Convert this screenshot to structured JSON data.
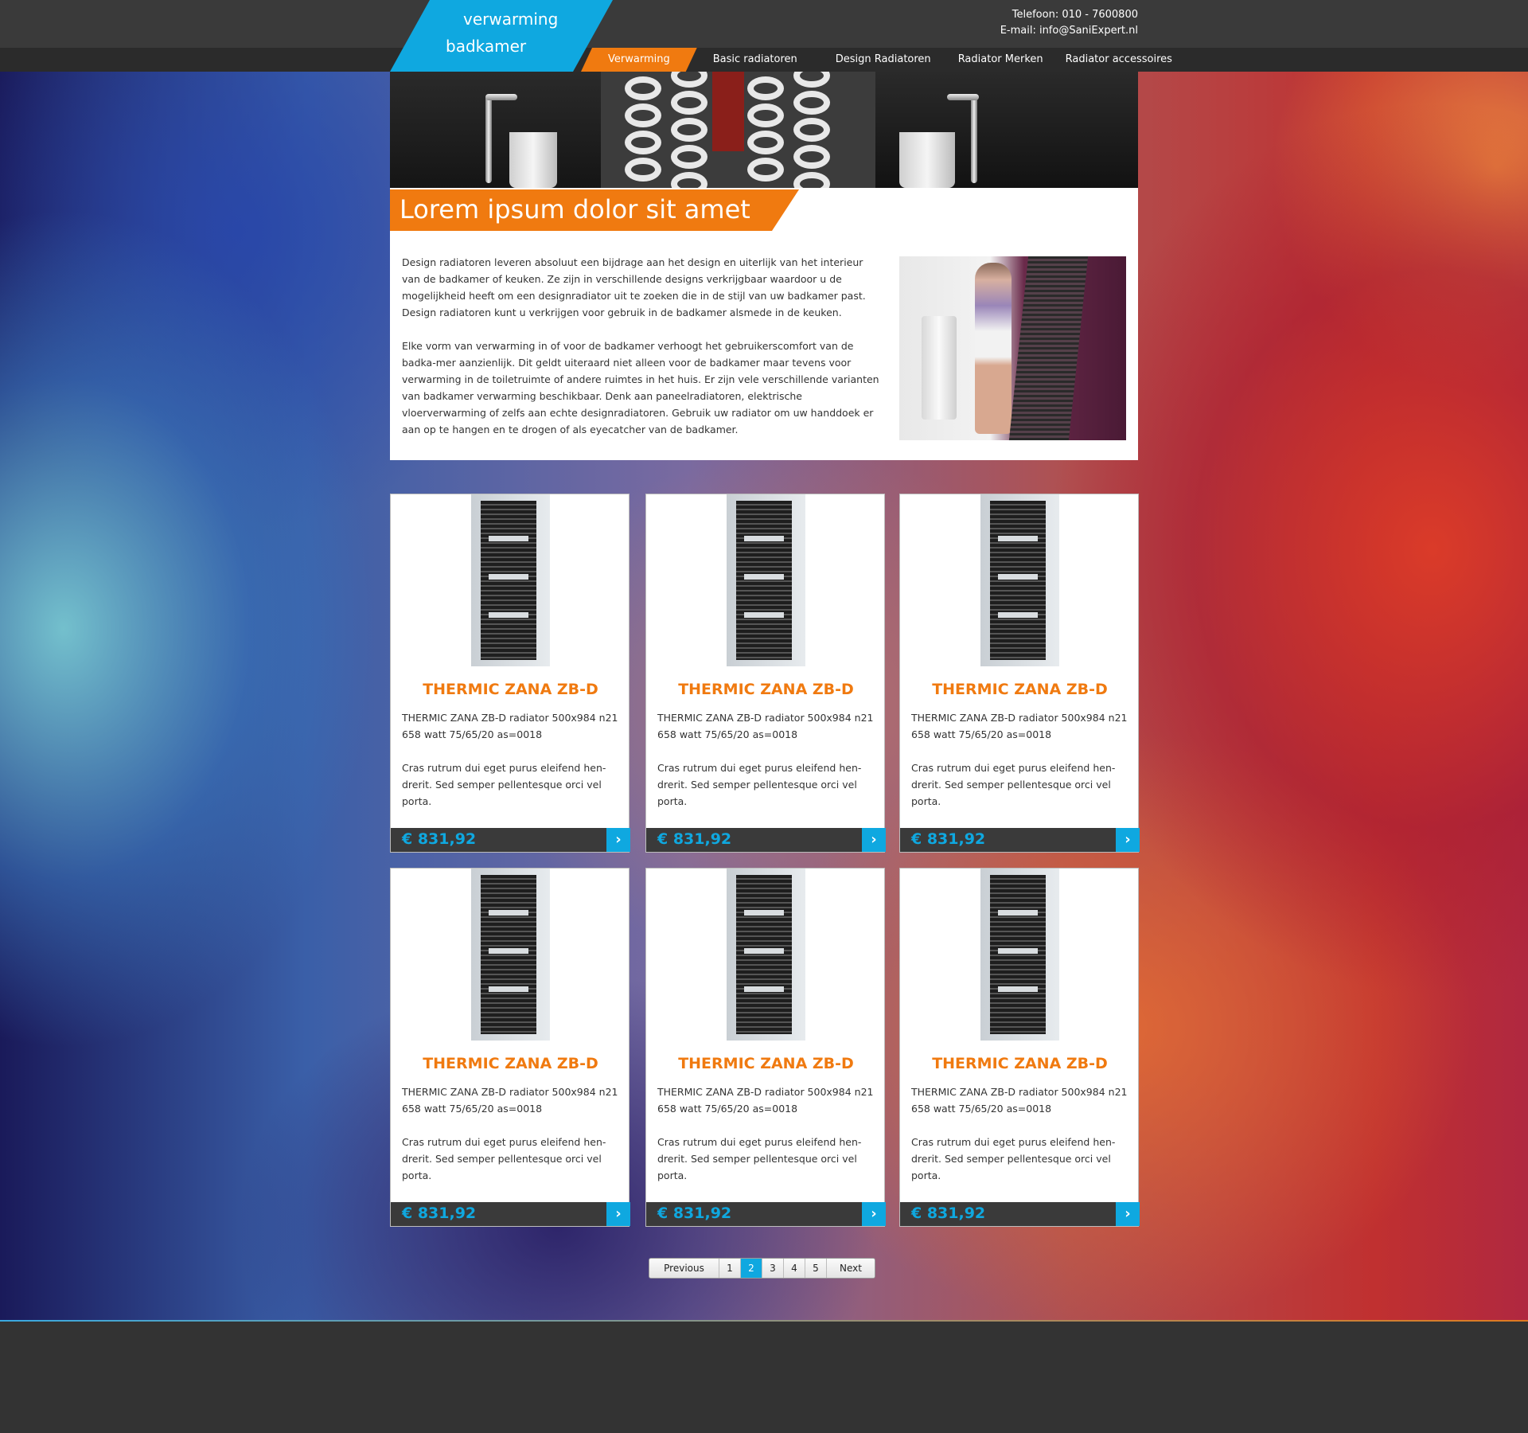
{
  "header": {
    "logo_line1": "verwarming",
    "logo_line2": "badkamer",
    "phone": "Telefoon: 010 - 7600800",
    "email": "E-mail: info@SaniExpert.nl"
  },
  "nav": {
    "items": [
      {
        "label": "Verwarming",
        "active": true
      },
      {
        "label": "Basic radiatoren"
      },
      {
        "label": "Design Radiatoren"
      },
      {
        "label": "Radiator Merken"
      },
      {
        "label": "Radiator accessoires"
      }
    ]
  },
  "intro": {
    "title": "Lorem ipsum dolor sit amet",
    "paragraph1": "Design radiatoren leveren absoluut een bijdrage aan het design en uiterlijk van het interieur van de badkamer of keuken. Ze zijn in verschillende designs verkrijgbaar waardoor u de mogelijkheid heeft om een designradiator uit te zoeken die in de stijl van uw badkamer past. Design radiatoren kunt u verkrijgen voor gebruik in de badkamer alsmede in de keuken.",
    "paragraph2": "Elke vorm van verwarming in of voor de badkamer verhoogt het gebruikerscomfort van de badka-mer aanzienlijk. Dit geldt uiteraard niet alleen voor de badkamer maar tevens voor verwarming in de toiletruimte of andere ruimtes in het huis. Er zijn vele verschillende varianten van badkamer verwarming beschikbaar. Denk aan paneelradiatoren, elektrische vloerverwarming of zelfs aan echte designradiatoren. Gebruik uw radiator om uw handdoek er aan op te hangen en te drogen of als eyecatcher van de badkamer."
  },
  "products": [
    {
      "title": "THERMIC ZANA ZB-D",
      "spec": "THERMIC ZANA ZB-D radiator 500x984 n21 658 watt 75/65/20 as=0018",
      "text": "Cras rutrum dui eget purus eleifend hen-drerit. Sed semper pellentesque orci vel porta.",
      "price": "€ 831,92",
      "arrow": "›"
    },
    {
      "title": "THERMIC ZANA ZB-D",
      "spec": "THERMIC ZANA ZB-D radiator 500x984 n21 658 watt 75/65/20 as=0018",
      "text": "Cras rutrum dui eget purus eleifend hen-drerit. Sed semper pellentesque orci vel porta.",
      "price": "€ 831,92",
      "arrow": "›"
    },
    {
      "title": "THERMIC ZANA ZB-D",
      "spec": "THERMIC ZANA ZB-D radiator 500x984 n21 658 watt 75/65/20 as=0018",
      "text": "Cras rutrum dui eget purus eleifend hen-drerit. Sed semper pellentesque orci vel porta.",
      "price": "€ 831,92",
      "arrow": "›"
    },
    {
      "title": "THERMIC ZANA ZB-D",
      "spec": "THERMIC ZANA ZB-D radiator 500x984 n21 658 watt 75/65/20 as=0018",
      "text": "Cras rutrum dui eget purus eleifend hen-drerit. Sed semper pellentesque orci vel porta.",
      "price": "€ 831,92",
      "arrow": "›"
    },
    {
      "title": "THERMIC ZANA ZB-D",
      "spec": "THERMIC ZANA ZB-D radiator 500x984 n21 658 watt 75/65/20 as=0018",
      "text": "Cras rutrum dui eget purus eleifend hen-drerit. Sed semper pellentesque orci vel porta.",
      "price": "€ 831,92",
      "arrow": "›"
    },
    {
      "title": "THERMIC ZANA ZB-D",
      "spec": "THERMIC ZANA ZB-D radiator 500x984 n21 658 watt 75/65/20 as=0018",
      "text": "Cras rutrum dui eget purus eleifend hen-drerit. Sed semper pellentesque orci vel porta.",
      "price": "€ 831,92",
      "arrow": "›"
    }
  ],
  "pagination": {
    "previous": "Previous",
    "next": "Next",
    "pages": [
      "1",
      "2",
      "3",
      "4",
      "5"
    ],
    "current": "2"
  },
  "colors": {
    "accent_orange": "#f07a10",
    "accent_blue": "#0fa8e0",
    "dark_bar": "#3a3a3a"
  }
}
